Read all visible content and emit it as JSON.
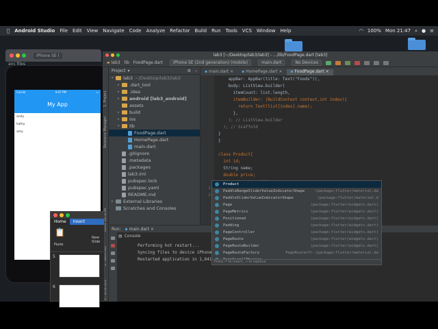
{
  "menubar": {
    "app": "Android Studio",
    "items": [
      "File",
      "Edit",
      "View",
      "Navigate",
      "Code",
      "Analyze",
      "Refactor",
      "Build",
      "Run",
      "Tools",
      "VCS",
      "Window",
      "Help"
    ],
    "battery": "100%",
    "clock": "Mon 21:47"
  },
  "simulator": {
    "title": "iPhone SE (",
    "side_label": "anc files",
    "status_carrier": "Carrier",
    "status_time": "9:47 PM",
    "app_title": "My App",
    "items": [
      "andy",
      "kathy",
      "amy"
    ]
  },
  "ide": {
    "title": "lab3 [~/Desktop/lab3/lab3] - .../lib/FoodPage.dart [lab3]",
    "toolbar": {
      "crumbs": [
        "lab3",
        "lib",
        "FoodPage.dart"
      ],
      "device": "iPhone SE (2nd generation) (mobile)",
      "run_config": "main.dart",
      "devices": "No Devices"
    },
    "project_label": "Project",
    "side_tools": [
      "1: Project",
      "Resource Manager",
      "Build Variants",
      "2: Favorites",
      "Z: Structure"
    ],
    "tree": [
      {
        "label": "lab3",
        "hint": "~/Desktop/lab3/lab3",
        "level": 0,
        "icon": "folder-icon",
        "arrow": "▾"
      },
      {
        "label": ".dart_tool",
        "level": 1,
        "icon": "folder-icon",
        "arrow": "▸"
      },
      {
        "label": ".idea",
        "level": 1,
        "icon": "folder-icon",
        "arrow": "▸"
      },
      {
        "label": "android [lab3_android]",
        "level": 1,
        "icon": "folder-icon",
        "arrow": "▸",
        "bold": true
      },
      {
        "label": "assets",
        "level": 1,
        "icon": "folder-icon",
        "arrow": ""
      },
      {
        "label": "build",
        "level": 1,
        "icon": "folder-icon",
        "arrow": "▸"
      },
      {
        "label": "ios",
        "level": 1,
        "icon": "folder-icon",
        "arrow": "▸"
      },
      {
        "label": "lib",
        "level": 1,
        "icon": "folder-icon",
        "arrow": "▾"
      },
      {
        "label": "FoodPage.dart",
        "level": 2,
        "icon": "dart-file-icon",
        "arrow": "",
        "selected": true
      },
      {
        "label": "HomePage.dart",
        "level": 2,
        "icon": "dart-file-icon",
        "arrow": ""
      },
      {
        "label": "main.dart",
        "level": 2,
        "icon": "dart-file-icon",
        "arrow": ""
      },
      {
        "label": ".gitignore",
        "level": 1,
        "icon": "file-icon",
        "arrow": ""
      },
      {
        "label": ".metadata",
        "level": 1,
        "icon": "file-icon",
        "arrow": ""
      },
      {
        "label": ".packages",
        "level": 1,
        "icon": "file-icon",
        "arrow": ""
      },
      {
        "label": "lab3.iml",
        "level": 1,
        "icon": "file-icon",
        "arrow": ""
      },
      {
        "label": "pubspec.lock",
        "level": 1,
        "icon": "file-icon",
        "arrow": ""
      },
      {
        "label": "pubspec.yaml",
        "level": 1,
        "icon": "file-icon",
        "arrow": ""
      },
      {
        "label": "README.md",
        "level": 1,
        "icon": "file-icon",
        "arrow": ""
      },
      {
        "label": "External Libraries",
        "level": 0,
        "icon": "library-icon",
        "arrow": "▸"
      },
      {
        "label": "Scratches and Consoles",
        "level": 0,
        "icon": "scratch-icon",
        "arrow": ""
      }
    ],
    "tabs": [
      "main.dart",
      "HomePage.dart",
      "FoodPage.dart"
    ],
    "code": [
      {
        "n": "",
        "t": "    appBar: AppBar(title: Text(\"Foods\")),"
      },
      {
        "n": "",
        "t": "    body: ListView.builder("
      },
      {
        "n": "",
        "t": "      itemCount: list.length,"
      },
      {
        "n": "",
        "t": "      itemBuilder: (BuildContext context,int index){"
      },
      {
        "n": "",
        "t": "        return Text(list[index].name);"
      },
      {
        "n": "",
        "t": "      },"
      },
      {
        "n": "",
        "t": "    ); // ListView.builder"
      },
      {
        "n": "",
        "t": "  ); // Scaffold"
      },
      {
        "n": "",
        "t": "}"
      },
      {
        "n": "",
        "t": "}"
      },
      {
        "n": "",
        "t": ""
      },
      {
        "n": "",
        "t": "class Product{"
      },
      {
        "n": "",
        "t": "  int id;"
      },
      {
        "n": "",
        "t": "  String name;"
      },
      {
        "n": "",
        "t": "  double price;"
      },
      {
        "n": "",
        "t": "  //constructor with name parameter support"
      },
      {
        "n": "23",
        "t": "  P"
      },
      {
        "n": "24",
        "t": ""
      }
    ],
    "autocomplete": {
      "items": [
        {
          "name": "Product",
          "pkg": ""
        },
        {
          "name": "PaddleRangeSliderValueIndicatorShape",
          "pkg": "(package:flutter/material.da"
        },
        {
          "name": "PaddleSliderValueIndicatorShape",
          "pkg": "(package:flutter/material.d"
        },
        {
          "name": "Page",
          "pkg": "(package:flutter/widgets.dart)"
        },
        {
          "name": "PageMetrics",
          "pkg": "(package:flutter/widgets.dart)"
        },
        {
          "name": "Positioned",
          "pkg": "(package:flutter/widgets.dart)"
        },
        {
          "name": "Padding",
          "pkg": "(package:flutter/widgets.dart)"
        },
        {
          "name": "PageController",
          "pkg": "(package:flutter/widgets.dart)"
        },
        {
          "name": "PageRoute",
          "pkg": "(package:flutter/widgets.dart)"
        },
        {
          "name": "PageRouteBuilder",
          "pkg": "(package:flutter/widgets.dart)"
        },
        {
          "name": "PageRouteFactory",
          "pkg": "PageRoute<T> (package:flutter/material.da"
        },
        {
          "name": "PageScrollPhysics",
          "pkg": ""
        }
      ],
      "hint": "Press ⏎ to insert, → to replace"
    },
    "run": {
      "label": "Run:",
      "config": "main.dart",
      "console": "Console",
      "lines": [
        "Performing hot restart...",
        "Syncing files to device iPhone SE",
        "Restarted application in 1,641ms."
      ]
    }
  },
  "word": {
    "tabs": [
      "Home",
      "Insert"
    ],
    "ribbon": [
      "Paste",
      "New Slide"
    ],
    "pages": [
      "5",
      "6"
    ]
  },
  "colors": {
    "accent": "#2196f3",
    "keyword": "#cc7832",
    "selection": "#0d293e"
  }
}
